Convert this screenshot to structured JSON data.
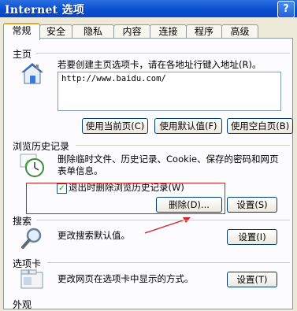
{
  "window": {
    "title": "Internet 选项",
    "help": "?"
  },
  "tabs": [
    "常规",
    "安全",
    "隐私",
    "内容",
    "连接",
    "程序",
    "高级"
  ],
  "homepage": {
    "section": "主页",
    "instruction": "若要创建主页选项卡，请在各地址行键入地址(R)。",
    "url": "http://www.baidu.com/",
    "btn_current": "使用当前页(C)",
    "btn_default": "使用默认值(F)",
    "btn_blank": "使用空白页(B)"
  },
  "history": {
    "section": "浏览历史记录",
    "desc_line1": "删除临时文件、历史记录、Cookie、保存的密码和网页",
    "desc_line2": "表单信息。",
    "checkbox_label": "退出时删除浏览历史记录(W)",
    "checkbox_checked": true,
    "checkmark": "✓",
    "btn_delete": "删除(D)...",
    "btn_settings": "设置(S)"
  },
  "search": {
    "section": "搜索",
    "desc": "更改搜索默认值。",
    "btn_settings": "设置(I)"
  },
  "tabbed": {
    "section": "选项卡",
    "desc": "更改网页在选项卡中显示的方式。",
    "btn_settings": "设置(T)"
  },
  "appearance": {
    "section": "外观"
  },
  "icons": {
    "home": "house-icon",
    "history": "history-clock-icon",
    "search": "magnifier-icon",
    "tabs": "tabs-window-icon"
  },
  "annotation": {
    "highlight_color": "#d42020"
  }
}
